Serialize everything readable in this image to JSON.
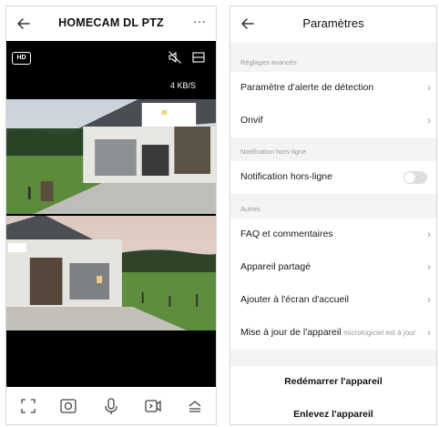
{
  "camera": {
    "title": "HOMECAM DL PTZ",
    "more_icon": "more-dots-icon",
    "quality_badge": "HD",
    "speed": "4 KB/S",
    "controls": [
      "fullscreen-icon",
      "snapshot-icon",
      "microphone-icon",
      "record-icon",
      "expand-up-icon"
    ]
  },
  "settings": {
    "title": "Paramètres",
    "sections": {
      "advanced": "Réglages avancés",
      "offline": "Notification hors-ligne",
      "other": "Autres"
    },
    "items": {
      "detection_alert": "Paramètre d'alerte de détection",
      "onvif": "Onvif",
      "offline_notification": "Notification hors-ligne",
      "faq": "FAQ et commentaires",
      "shared": "Appareil partagé",
      "home_screen": "Ajouter à l'écran d'accueil",
      "firmware": "Mise à jour de l'appareil",
      "firmware_status": "Le micrologiciel est à jour"
    },
    "offline_notification_enabled": false,
    "actions": {
      "restart": "Redémarrer l'appareil",
      "remove": "Enlevez l'appareil"
    }
  },
  "colors": {
    "video_background": "#000000",
    "settings_background": "#f4f4f6",
    "toggle_off": "#dedede"
  }
}
